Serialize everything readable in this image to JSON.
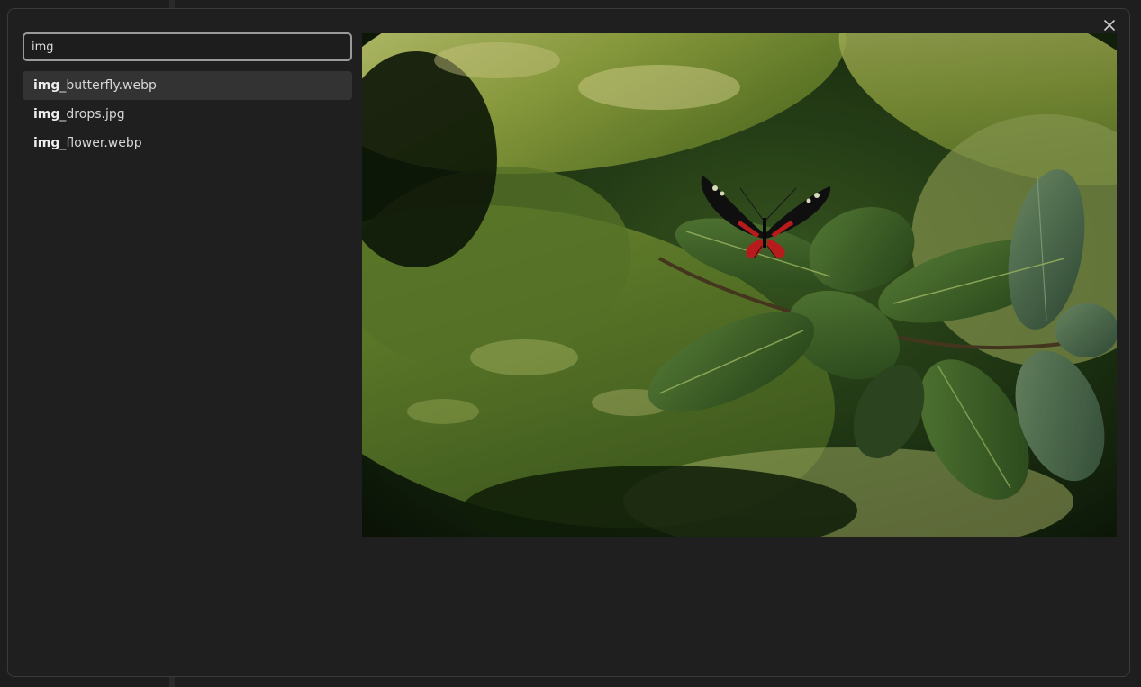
{
  "quick_switcher": {
    "search": {
      "value": "img",
      "placeholder": ""
    },
    "results": [
      {
        "match": "img",
        "rest": "_butterfly.webp",
        "selected": true
      },
      {
        "match": "img",
        "rest": "_drops.jpg",
        "selected": false
      },
      {
        "match": "img",
        "rest": "_flower.webp",
        "selected": false
      }
    ],
    "close_icon": "close-icon",
    "preview_icon": "butterfly-on-leaves-photo"
  },
  "colors": {
    "modal_bg": "#1f1f1f",
    "selected_row": "#333333",
    "input_border": "#9a9a9a",
    "text": "#d6d6d6"
  }
}
